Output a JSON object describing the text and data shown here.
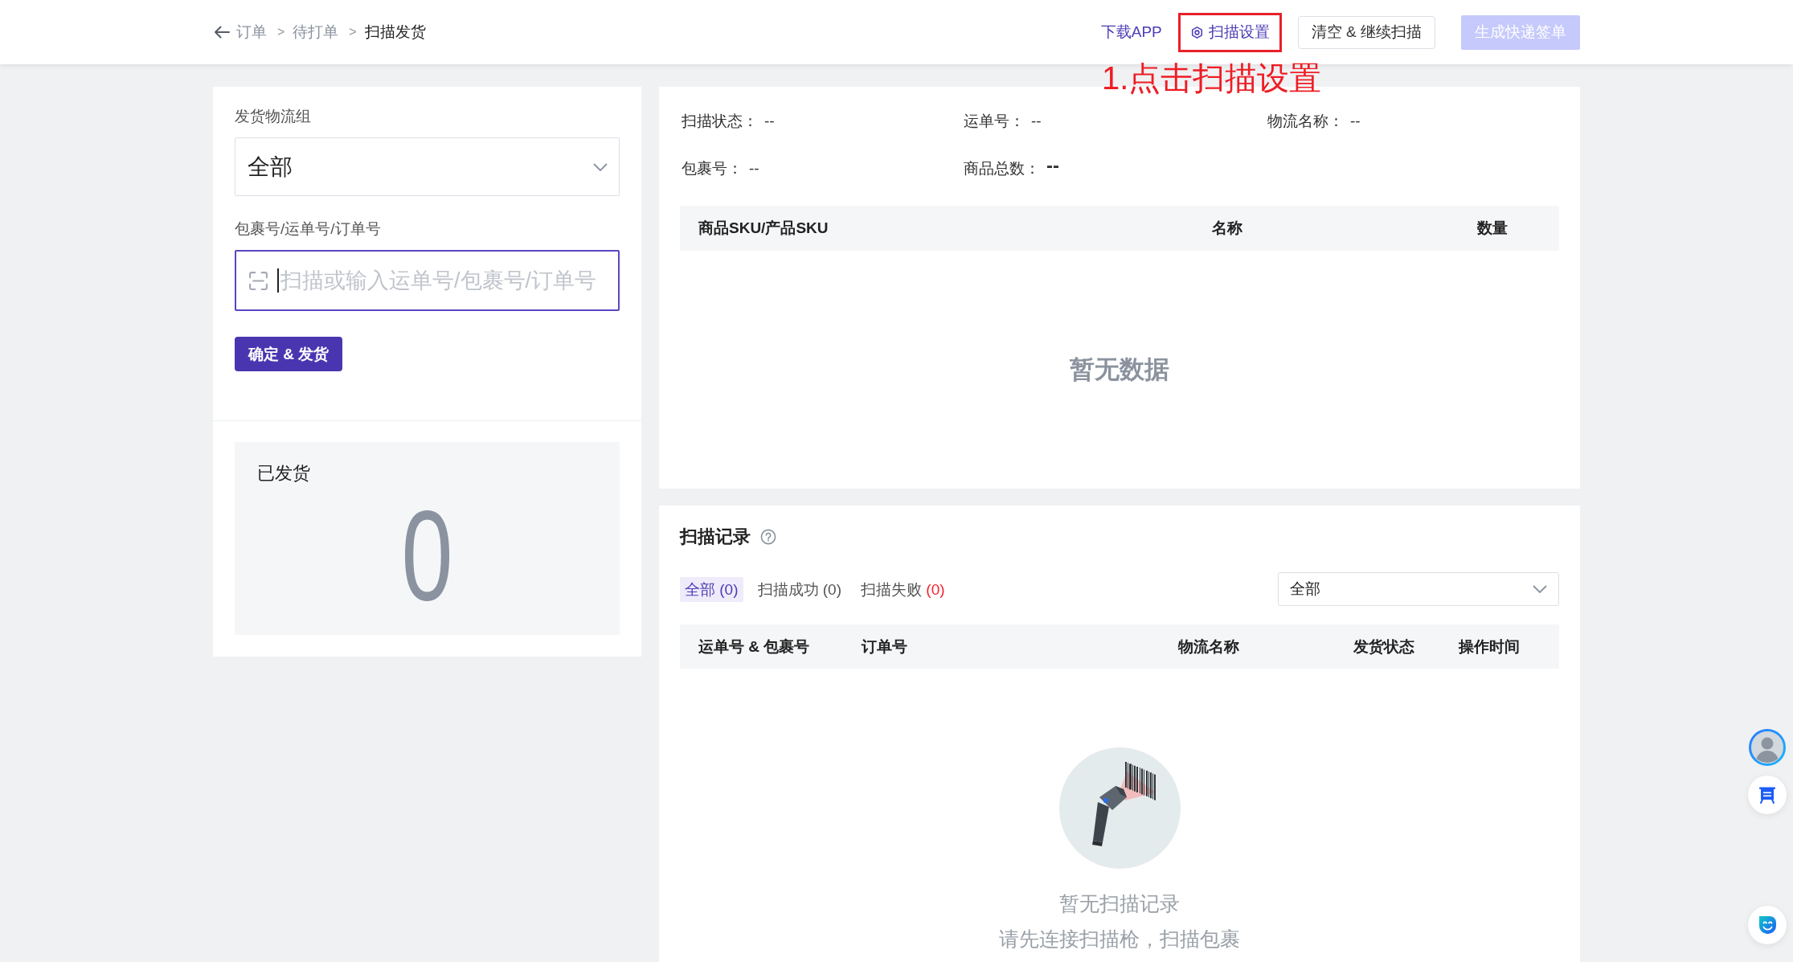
{
  "header": {
    "breadcrumb": [
      {
        "label": "订单",
        "current": false
      },
      {
        "separator": ">",
        "label": "待打单",
        "current": false
      },
      {
        "separator": ">",
        "label": "扫描发货",
        "current": true
      }
    ],
    "actions": [
      {
        "kind": "link",
        "label": "下载APP",
        "highlighted": false,
        "disabled": false
      },
      {
        "kind": "settings",
        "label": "扫描设置",
        "highlighted": true,
        "disabled": false
      },
      {
        "kind": "button",
        "label": "清空 & 继续扫描",
        "highlighted": false,
        "disabled": false
      },
      {
        "kind": "primary",
        "label": "生成快递签单",
        "highlighted": false,
        "disabled": true
      }
    ]
  },
  "annotation": {
    "text": "1.点击扫描设置"
  },
  "shipping_form": {
    "group_label": "发货物流组",
    "group_value": "全部",
    "number_label": "包裹号/运单号/订单号",
    "number_field": {
      "placeholder": "扫描或输入运单号/包裹号/订单号",
      "focused": true
    },
    "submit_button": "确定 & 发货"
  },
  "shipped_card": {
    "label": "已发货",
    "value": "0"
  },
  "scan_details": {
    "rows": [
      {
        "fields": [
          {
            "kind": "text",
            "label": "扫描状态：",
            "value": "--"
          },
          {
            "kind": "text",
            "label": "运单号：",
            "value": "--"
          },
          {
            "kind": "text",
            "label": "物流名称：",
            "value": "--"
          }
        ]
      },
      {
        "fields": [
          {
            "kind": "text",
            "label": "包裹号：",
            "value": "--"
          },
          {
            "kind": "count",
            "label": "商品总数：",
            "value": "--"
          }
        ]
      }
    ],
    "table": {
      "columns": [
        "商品SKU/产品SKU",
        "名称",
        "数量"
      ],
      "empty_text": "暂无数据"
    }
  },
  "scan_records": {
    "title": "扫描记录",
    "tabs": [
      {
        "kind": "all",
        "label": "全部",
        "count": "(0)",
        "selected": true
      },
      {
        "kind": "success",
        "label": "扫描成功",
        "count": "(0)",
        "selected": false
      },
      {
        "kind": "failed",
        "label": "扫描失败",
        "count": "(0)",
        "selected": false
      }
    ],
    "filter": {
      "value": "全部"
    },
    "table": {
      "columns": [
        "运单号 & 包裹号",
        "订单号",
        "物流名称",
        "发货状态",
        "操作时间"
      ]
    },
    "empty": {
      "title": "暂无扫描记录",
      "hint": "请先连接扫描枪，扫描包裹"
    }
  }
}
